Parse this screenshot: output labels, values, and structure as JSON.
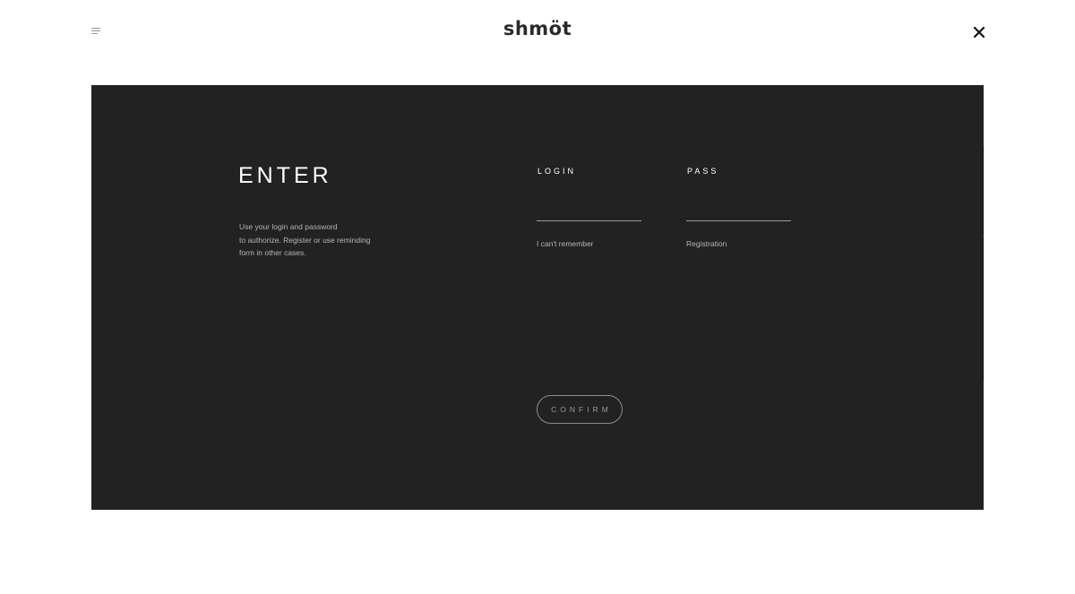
{
  "header": {
    "logo_text": "shmöt",
    "menu_icon": "hamburger-menu-icon",
    "close_icon": "close-x-icon"
  },
  "panel": {
    "title": "ENTER",
    "description": "Use your login and password\nto authorize. Register or use reminding\nform in other cases.",
    "login": {
      "label": "LOGIN",
      "value": "",
      "placeholder": "",
      "link": "I can't remember"
    },
    "pass": {
      "label": "PASS",
      "value": "",
      "placeholder": "",
      "link": "Registration"
    },
    "confirm_label": "CONFIRM"
  },
  "colors": {
    "background": "#ffffff",
    "panel": "#222222",
    "text_primary": "#ffffff",
    "text_secondary": "#b5b5b5",
    "logo": "#2a2a2a"
  }
}
